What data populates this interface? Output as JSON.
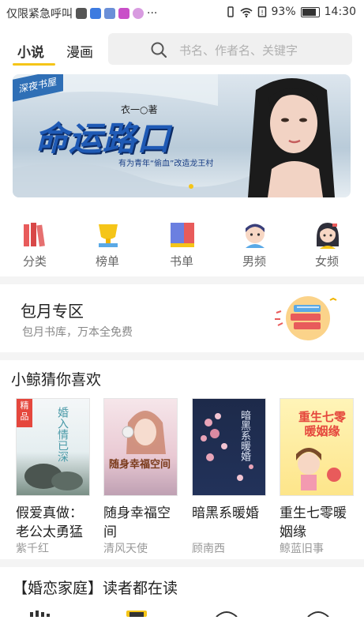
{
  "status_bar": {
    "notice": "仅限紧急呼叫",
    "dots": "···",
    "battery": "93%",
    "time": "14:30"
  },
  "nav": {
    "tabs": [
      {
        "label": "小说",
        "active": true
      },
      {
        "label": "漫画",
        "active": false
      }
    ],
    "search_placeholder": "书名、作者名、关键字"
  },
  "banner": {
    "tag": "深夜书屋",
    "author": "衣一○著",
    "title": "命运路口",
    "subtitle": "有为青年“偷血”改造龙王村"
  },
  "categories": [
    {
      "label": "分类",
      "icon": "books-icon"
    },
    {
      "label": "榜单",
      "icon": "trophy-icon"
    },
    {
      "label": "书单",
      "icon": "booklist-icon"
    },
    {
      "label": "男频",
      "icon": "boy-icon"
    },
    {
      "label": "女频",
      "icon": "girl-icon"
    }
  ],
  "monthly": {
    "title": "包月专区",
    "subtitle": "包月书库，万本全免费"
  },
  "recommend": {
    "title": "小鲸猜你喜欢",
    "books": [
      {
        "title": "假爱真做：老公太勇猛",
        "author": "紫千红",
        "badge": "精品",
        "cover_text": "婚入情已深"
      },
      {
        "title": "随身幸福空间",
        "author": "清风天使",
        "badge": "",
        "cover_text": "随身幸福空间"
      },
      {
        "title": "暗黑系暖婚",
        "author": "顾南西",
        "badge": "",
        "cover_text": "暗黑系暖婚"
      },
      {
        "title": "重生七零暖姻缘",
        "author": "鲸蓝旧事",
        "badge": "",
        "cover_text": "重生七零暖姻缘"
      }
    ]
  },
  "section2": {
    "title": "【婚恋家庭】读者都在读"
  },
  "colors": {
    "accent": "#f5c518",
    "banner_blue": "#1f5ab5",
    "badge_red": "#e5473d"
  }
}
